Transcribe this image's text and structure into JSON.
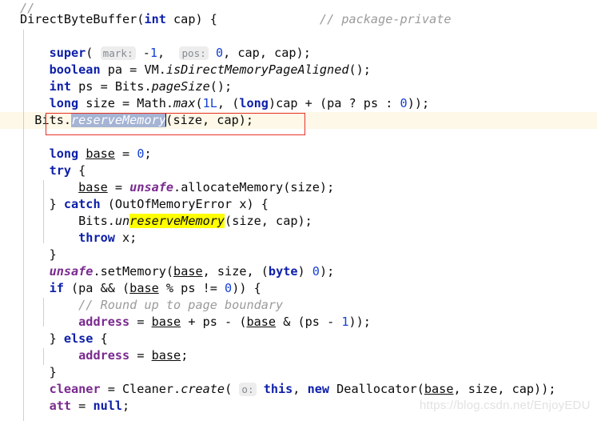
{
  "editor": {
    "theme": "light",
    "background": "#ffffff",
    "caret_line_color": "#fdf8e7",
    "selection_color": "#a5b4d4",
    "find_highlight_color": "#ffff00",
    "annotation_box_color": "#e8312b",
    "keyword_color": "#0d1fa8",
    "number_color": "#1742d6",
    "comment_color": "#9b9b9b",
    "static_field_color": "#7a2a8f",
    "hint_color": "#868b92",
    "caret_line_number": 6,
    "language": "Java"
  },
  "code": {
    "l1_comment": "//",
    "l2_ctor": "DirectByteBuffer(",
    "l2_kw_int": "int",
    "l2_param": " cap) {",
    "l2_trailing_comment": "// package-private",
    "l4_kw_super": "super",
    "l4_open": "(",
    "l4_hint_mark": "mark:",
    "l4_minus": "-",
    "l4_val_1": "1",
    "l4_comma1": ", ",
    "l4_hint_pos": "pos:",
    "l4_val_0": "0",
    "l4_rest": ", cap, cap);",
    "l5_kw": "boolean",
    "l5_mid": " pa = VM.",
    "l5_meth": "isDirectMemoryPageAligned",
    "l5_end": "();",
    "l6_kw": "int",
    "l6_mid": " ps = Bits.",
    "l6_meth": "pageSize",
    "l6_end": "();",
    "l7_kw": "long",
    "l7_a": " size = Math.",
    "l7_meth": "max",
    "l7_b": "(",
    "l7_num1": "1L",
    "l7_c": ", (",
    "l7_kw2": "long",
    "l7_d": ")cap + (pa ? ps : ",
    "l7_num2": "0",
    "l7_e": "));",
    "l8_pre": "Bits.",
    "l8_selected": "reserveMemory",
    "l8_post": "(size, cap);",
    "l10_kw": "long",
    "l10_var": "base",
    "l10_mid": " = ",
    "l10_num": "0",
    "l10_end": ";",
    "l11_kw": "try",
    "l11_rest": " {",
    "l12_var": "base",
    "l12_mid": " = ",
    "l12_static": "unsafe",
    "l12_end": ".allocateMemory(size);",
    "l13_pre": "} ",
    "l13_kw": "catch",
    "l13_rest": " (OutOfMemoryError x) {",
    "l14_pre": "Bits.",
    "l14_un": "un",
    "l14_found": "reserveMemory",
    "l14_post": "(size, cap);",
    "l15_kw": "throw",
    "l15_rest": " x;",
    "l16_brace": "}",
    "l17_static": "unsafe",
    "l17_a": ".setMemory(",
    "l17_var": "base",
    "l17_b": ", size, (",
    "l17_kw": "byte",
    "l17_c": ") ",
    "l17_num": "0",
    "l17_d": ");",
    "l18_kw": "if",
    "l18_a": " (pa && (",
    "l18_var": "base",
    "l18_b": " % ps != ",
    "l18_num": "0",
    "l18_c": ")) {",
    "l19_comment": "// Round up to page boundary",
    "l20_field": "address",
    "l20_a": " = ",
    "l20_var1": "base",
    "l20_b": " + ps - (",
    "l20_var2": "base",
    "l20_c": " & (ps - ",
    "l20_num": "1",
    "l20_d": "));",
    "l21_pre": "} ",
    "l21_kw": "else",
    "l21_rest": " {",
    "l22_field": "address",
    "l22_a": " = ",
    "l22_var": "base",
    "l22_b": ";",
    "l23_brace": "}",
    "l24_field": "cleaner",
    "l24_a": " = Cleaner.",
    "l24_meth": "create",
    "l24_b": "(",
    "l24_hint_o": "o:",
    "l24_kw_this": "this",
    "l24_c": ", ",
    "l24_kw_new": "new",
    "l24_d": " Deallocator(",
    "l24_var": "base",
    "l24_e": ", size, cap));",
    "l25_field": "att",
    "l25_a": " = ",
    "l25_kw_null": "null",
    "l25_b": ";"
  },
  "watermark": {
    "text": "https://blog.csdn.net/EnjoyEDU"
  }
}
